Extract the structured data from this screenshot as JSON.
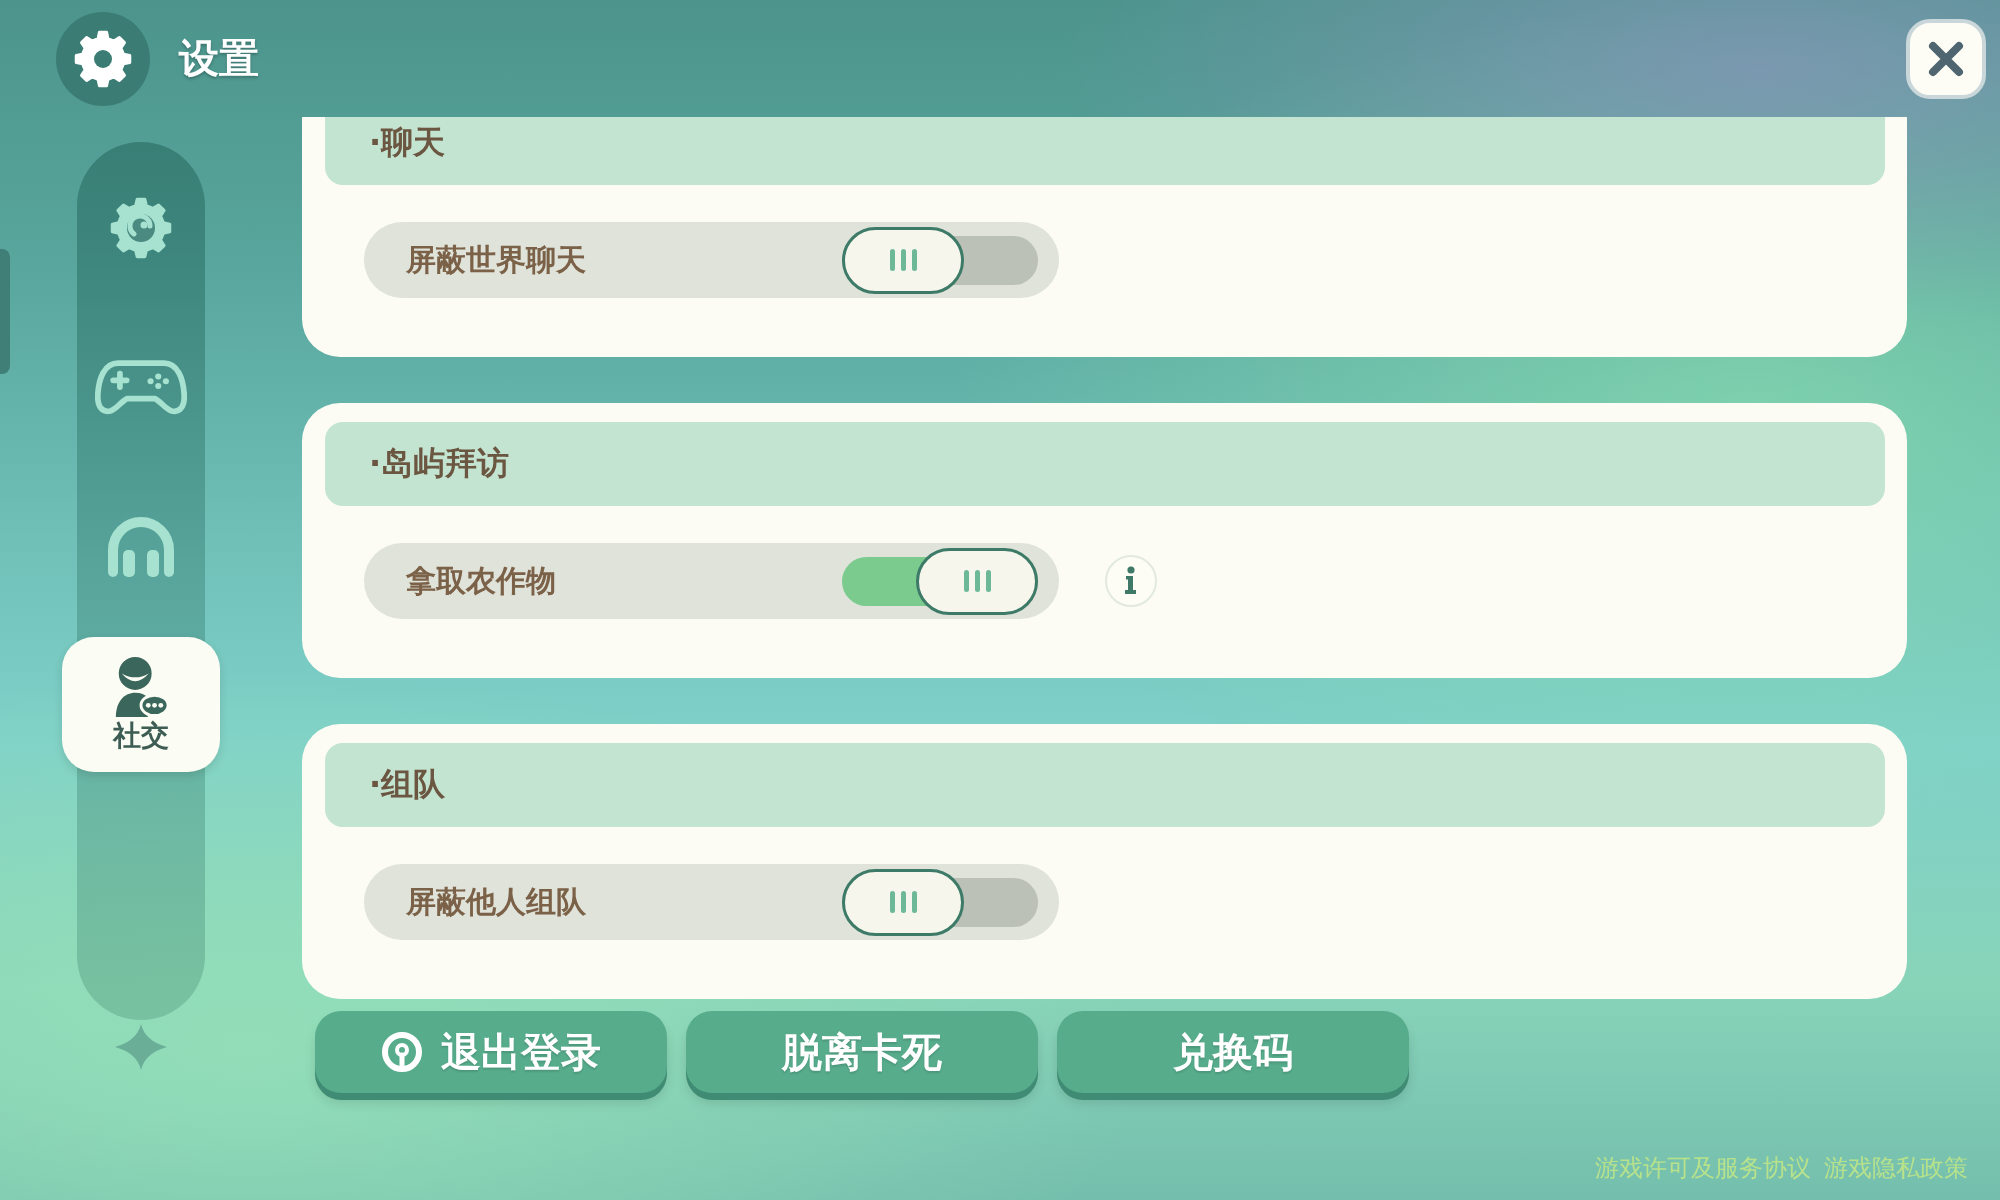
{
  "header": {
    "title": "设置"
  },
  "sidebar": {
    "items": [
      {
        "kind": "gear",
        "selected": false
      },
      {
        "kind": "gamepad",
        "selected": false
      },
      {
        "kind": "headphones",
        "selected": false
      },
      {
        "kind": "person",
        "label": "社交",
        "selected": true
      }
    ]
  },
  "sections": [
    {
      "title": "·聊天",
      "settings": [
        {
          "label": "屏蔽世界聊天",
          "on": false
        }
      ]
    },
    {
      "title": "·岛屿拜访",
      "settings": [
        {
          "label": "拿取农作物",
          "on": true,
          "info": true
        }
      ]
    },
    {
      "title": "·组队",
      "settings": [
        {
          "label": "屏蔽他人组队",
          "on": false
        }
      ]
    }
  ],
  "actions": [
    {
      "kind": "logout",
      "label": "退出登录"
    },
    {
      "kind": "plain",
      "label": "脱离卡死"
    },
    {
      "kind": "plain",
      "label": "兑换码"
    }
  ],
  "footer": {
    "links": [
      "游戏许可及服务协议",
      "游戏隐私政策"
    ]
  }
}
